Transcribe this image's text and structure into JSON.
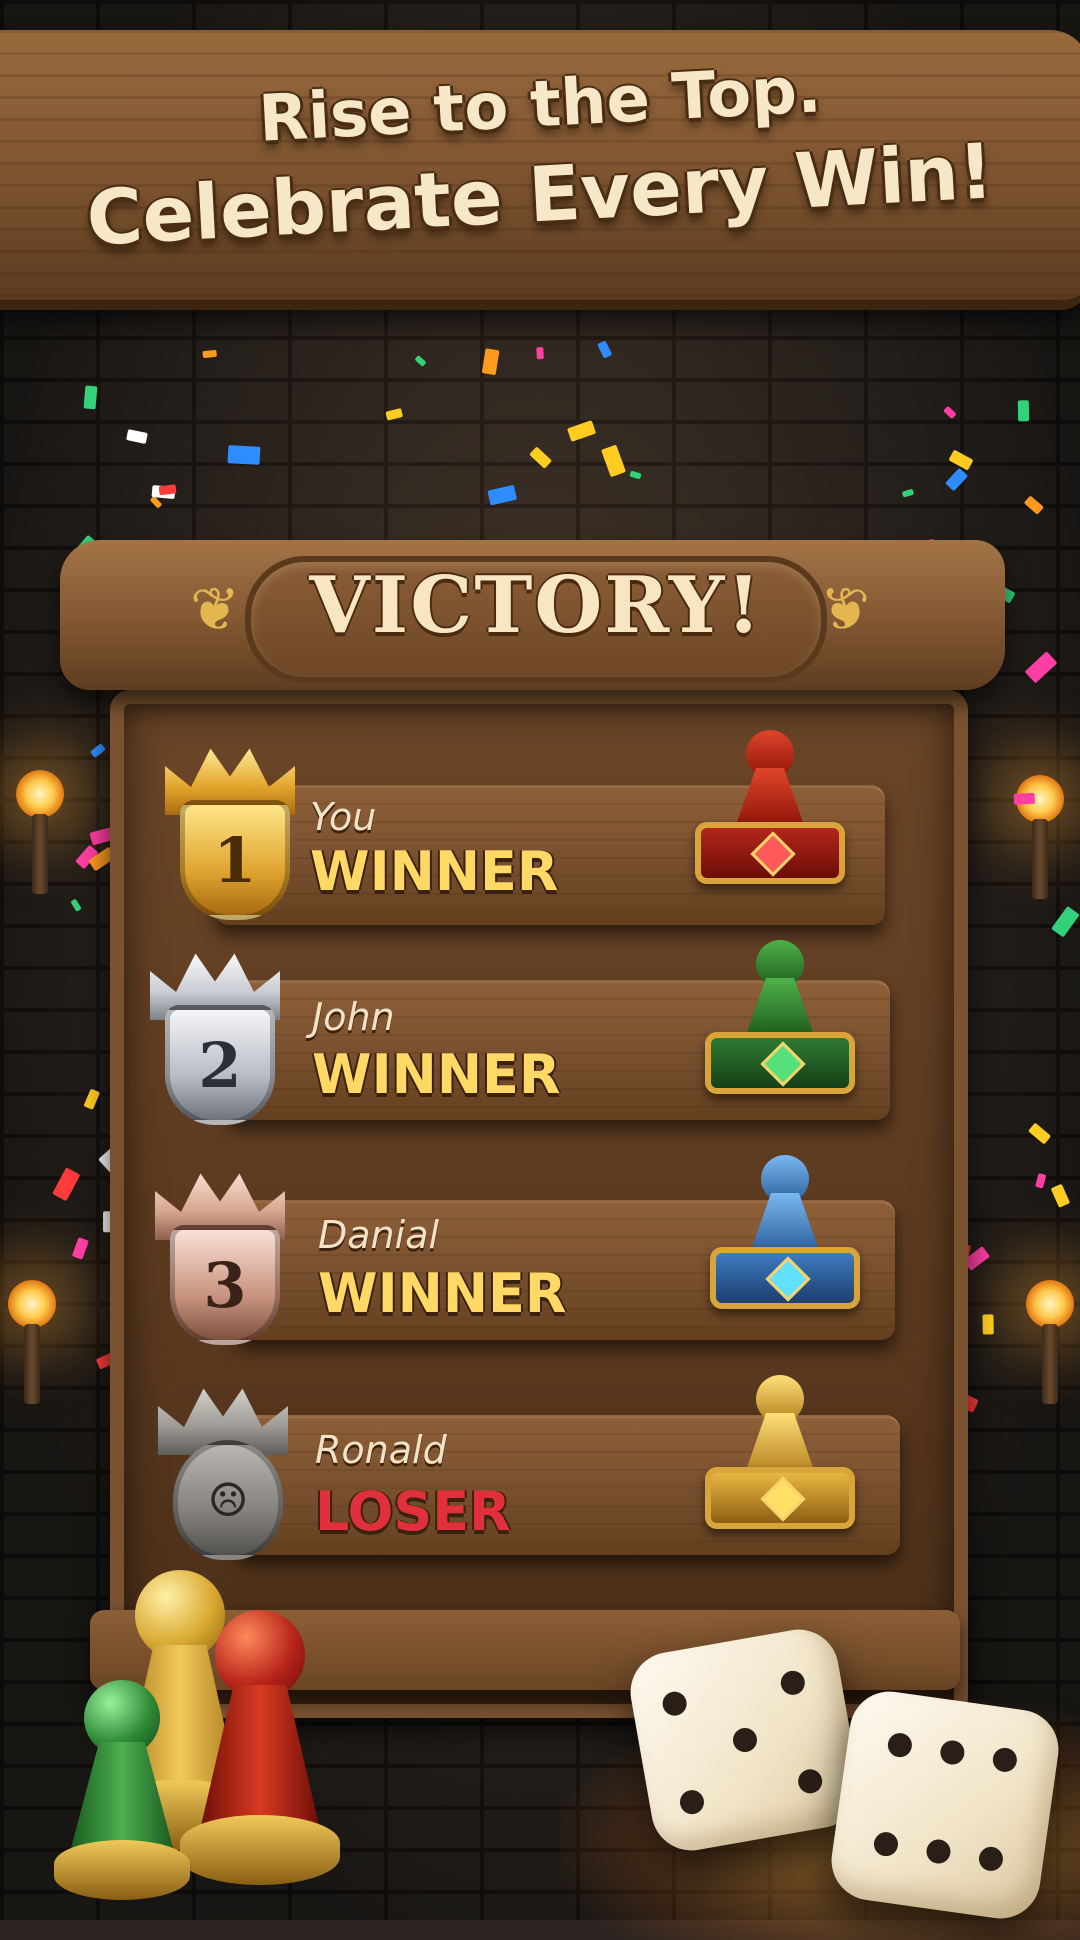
{
  "headline": {
    "line1": "Rise to the Top.",
    "line2": "Celebrate Every Win!"
  },
  "victory": {
    "title": "VICTORY!"
  },
  "colors": {
    "winner_text": "#ffd865",
    "loser_text": "#e0303c",
    "wood": "#7a5130"
  },
  "results": [
    {
      "rank": "1",
      "name": "You",
      "status": "WINNER",
      "badge": "gold-crown-rank-1",
      "pawn": "red-pawn-trophy"
    },
    {
      "rank": "2",
      "name": "John",
      "status": "WINNER",
      "badge": "silver-crown-rank-2",
      "pawn": "green-pawn-trophy"
    },
    {
      "rank": "3",
      "name": "Danial",
      "status": "WINNER",
      "badge": "bronze-crown-rank-3",
      "pawn": "blue-pawn-trophy"
    },
    {
      "rank": "☹",
      "name": "Ronald",
      "status": "LOSER",
      "badge": "stone-crown-sad-face",
      "pawn": "gold-pawn-trophy"
    }
  ],
  "decorations": {
    "dice": [
      "die-left",
      "die-right"
    ],
    "pawns": [
      "green-pawn",
      "gold-pawn",
      "red-pawn"
    ],
    "torches": 4,
    "confetti": true
  }
}
